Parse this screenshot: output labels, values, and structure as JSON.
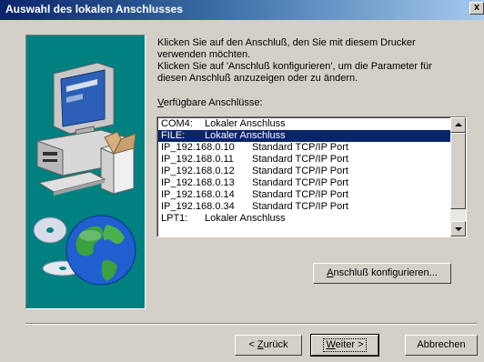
{
  "window": {
    "title": "Auswahl des lokalen Anschlusses",
    "close_symbol": "x",
    "titlebar_colors": [
      "#0a246a",
      "#a6caf0"
    ]
  },
  "illustration": {
    "background": "#008080",
    "depicts": [
      "computer-icon",
      "cd-icon",
      "globe-icon"
    ]
  },
  "instructions": {
    "line1": "Klicken Sie auf den Anschluß, den Sie mit diesem Drucker",
    "line2": "verwenden möchten.",
    "line3": "Klicken Sie auf 'Anschluß konfigurieren', um die Parameter für",
    "line4": "diesen Anschluß anzuzeigen oder zu ändern."
  },
  "ports": {
    "label_prefix": "",
    "label_accel": "V",
    "label_rest": "erfügbare Anschlüsse:",
    "selected_index": 1,
    "rows": [
      {
        "port": "COM4:",
        "description": "Lokaler Anschluss"
      },
      {
        "port": "FILE:",
        "description": "Lokaler Anschluss"
      },
      {
        "port": "IP_192.168.0.10",
        "description": "Standard TCP/IP Port"
      },
      {
        "port": "IP_192.168.0.11",
        "description": "Standard TCP/IP Port"
      },
      {
        "port": "IP_192.168.0.12",
        "description": "Standard TCP/IP Port"
      },
      {
        "port": "IP_192.168.0.13",
        "description": "Standard TCP/IP Port"
      },
      {
        "port": "IP_192.168.0.14",
        "description": "Standard TCP/IP Port"
      },
      {
        "port": "IP_192.168.0.34",
        "description": "Standard TCP/IP Port"
      },
      {
        "port": "LPT1:",
        "description": "Lokaler Anschluss"
      }
    ]
  },
  "buttons": {
    "configure": {
      "accel": "A",
      "rest": "nschluß konfigurieren..."
    },
    "back": {
      "pre": "< ",
      "accel": "Z",
      "rest": "urück"
    },
    "next": {
      "accel": "W",
      "rest": "eiter >"
    },
    "cancel": {
      "label": "Abbrechen"
    }
  },
  "colors": {
    "face": "#d4d0c8",
    "selection": "#0a246a",
    "teal": "#008080"
  }
}
